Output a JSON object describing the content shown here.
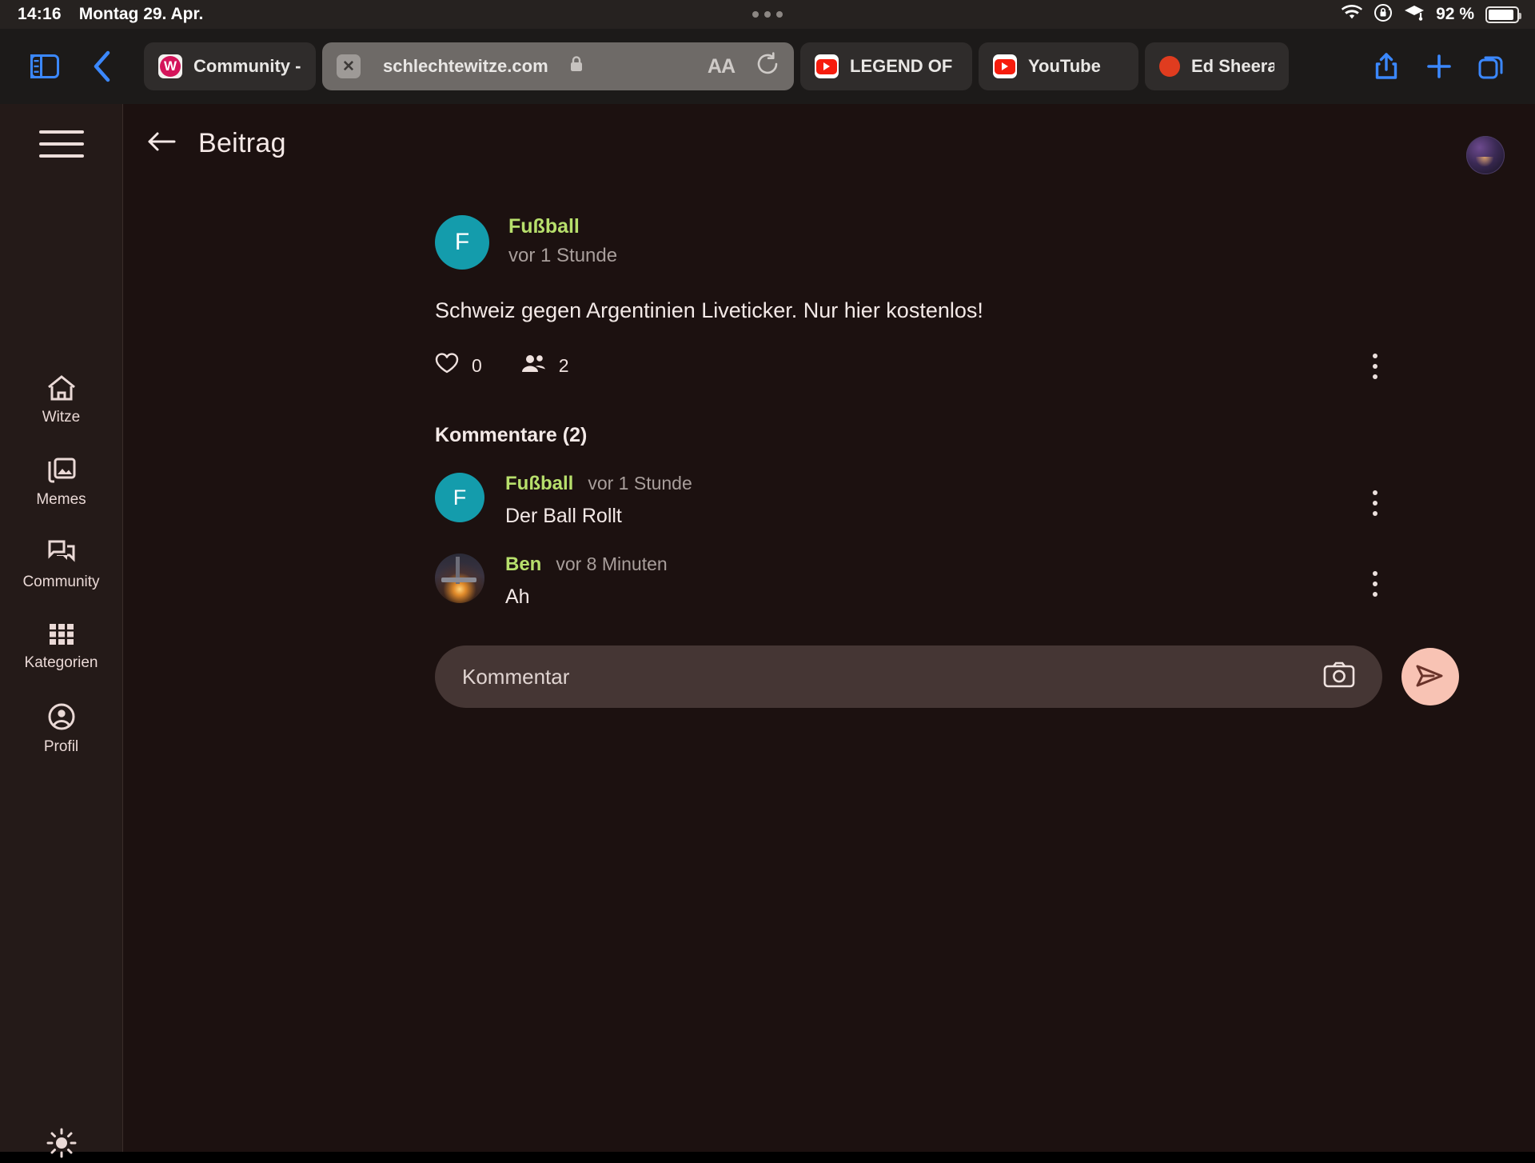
{
  "status_bar": {
    "time": "14:16",
    "date": "Montag 29. Apr.",
    "battery_percent": "92 %",
    "icons": [
      "wifi-icon",
      "rotation-lock-icon",
      "focus-study-icon",
      "battery-icon"
    ]
  },
  "browser": {
    "sidebar_toggle_icon": "sidebar-icon",
    "back_icon": "chevron-left-icon",
    "tabs": [
      {
        "title": "Community - ",
        "favicon": "witze-w-icon",
        "active": false
      },
      {
        "title": "schlechtewitze.com",
        "favicon": "close-icon",
        "active": true,
        "secure": true
      },
      {
        "title": "LEGEND OF Z",
        "favicon": "youtube-icon",
        "active": false
      },
      {
        "title": "YouTube",
        "favicon": "youtube-icon",
        "active": false
      },
      {
        "title": "Ed Sheeran - ",
        "favicon": "soundcloud-icon",
        "active": false
      }
    ],
    "active_tab_actions": {
      "text_size_label": "AA",
      "reload_icon": "reload-icon"
    },
    "toolbar": {
      "share_icon": "share-icon",
      "new_tab_icon": "plus-icon",
      "tab_overview_icon": "tabs-icon"
    },
    "accent_color": "#3b88fe"
  },
  "sidebar": {
    "menu_icon": "hamburger-icon",
    "items": [
      {
        "label": "Witze",
        "icon": "home-icon"
      },
      {
        "label": "Memes",
        "icon": "photo-library-icon"
      },
      {
        "label": "Community",
        "icon": "chat-bubbles-icon",
        "active": true
      },
      {
        "label": "Kategorien",
        "icon": "grid-icon"
      },
      {
        "label": "Profil",
        "icon": "account-circle-icon"
      }
    ],
    "theme_toggle_icon": "sun-icon",
    "background_color": "#241a18"
  },
  "header": {
    "back_icon": "arrow-left-icon",
    "title": "Beitrag",
    "avatar": "user-avatar"
  },
  "post": {
    "avatar_initial": "F",
    "avatar_color": "#149cac",
    "author": "Fußball",
    "author_color": "#b7df6c",
    "timestamp": "vor 1 Stunde",
    "body": "Schweiz gegen Argentinien Liveticker. Nur hier kostenlos!",
    "likes": {
      "icon": "heart-outline-icon",
      "count": "0"
    },
    "participants": {
      "icon": "people-icon",
      "count": "2"
    },
    "menu_icon": "more-vertical-icon"
  },
  "comments_section": {
    "title": "Kommentare (2)",
    "items": [
      {
        "avatar_initial": "F",
        "avatar_type": "initial",
        "author": "Fußball",
        "timestamp": "vor 1 Stunde",
        "text": "Der Ball Rollt",
        "menu_icon": "more-vertical-icon"
      },
      {
        "avatar_initial": "",
        "avatar_type": "photo",
        "author": "Ben",
        "timestamp": "vor 8 Minuten",
        "text": "Ah",
        "menu_icon": "more-vertical-icon"
      }
    ]
  },
  "composer": {
    "placeholder": "Kommentar",
    "value": "",
    "camera_icon": "camera-icon",
    "send_icon": "send-icon",
    "send_button_color": "#f8c3b4"
  }
}
